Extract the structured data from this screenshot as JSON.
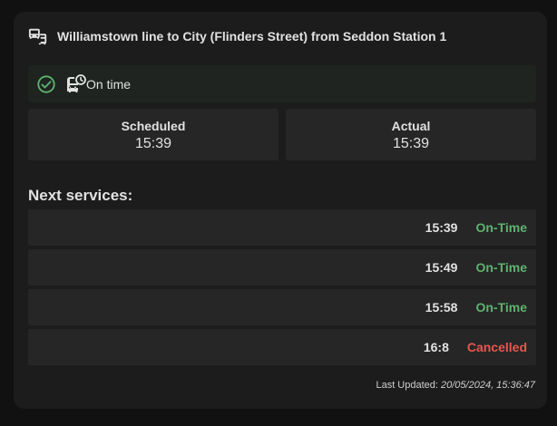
{
  "header": {
    "title": "Williamstown line to City (Flinders Street) from Seddon Station  1",
    "icon": "tram-bus-icon"
  },
  "status": {
    "text": "On time",
    "check_icon": "check-circle-icon",
    "bus_icon": "bus-clock-icon",
    "color": "#5fb370"
  },
  "times": {
    "scheduled_label": "Scheduled",
    "scheduled_value": "15:39",
    "actual_label": "Actual",
    "actual_value": "15:39"
  },
  "next_services": {
    "title": "Next services:",
    "items": [
      {
        "time": "15:39",
        "status": "On-Time",
        "color": "#5fb370"
      },
      {
        "time": "15:49",
        "status": "On-Time",
        "color": "#5fb370"
      },
      {
        "time": "15:58",
        "status": "On-Time",
        "color": "#5fb370"
      },
      {
        "time": "16:8",
        "status": "Cancelled",
        "color": "#e8564f"
      }
    ]
  },
  "footer": {
    "label": "Last Updated:",
    "timestamp": "20/05/2024, 15:36:47"
  }
}
